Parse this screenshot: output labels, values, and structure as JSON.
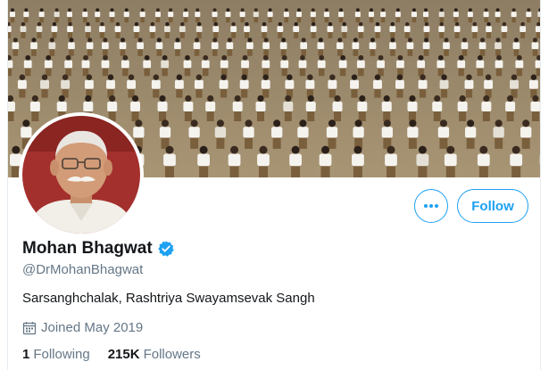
{
  "profile": {
    "display_name": "Mohan Bhagwat",
    "handle": "@DrMohanBhagwat",
    "bio": "Sarsanghchalak, Rashtriya Swayamsevak Sangh",
    "joined": "Joined May 2019",
    "verified": true
  },
  "actions": {
    "follow_label": "Follow",
    "more_icon": "more-icon"
  },
  "stats": {
    "following_count": "1",
    "following_label": "Following",
    "followers_count": "215K",
    "followers_label": "Followers"
  },
  "colors": {
    "accent": "#1da1f2",
    "secondary_text": "#657786",
    "primary_text": "#14171a"
  }
}
